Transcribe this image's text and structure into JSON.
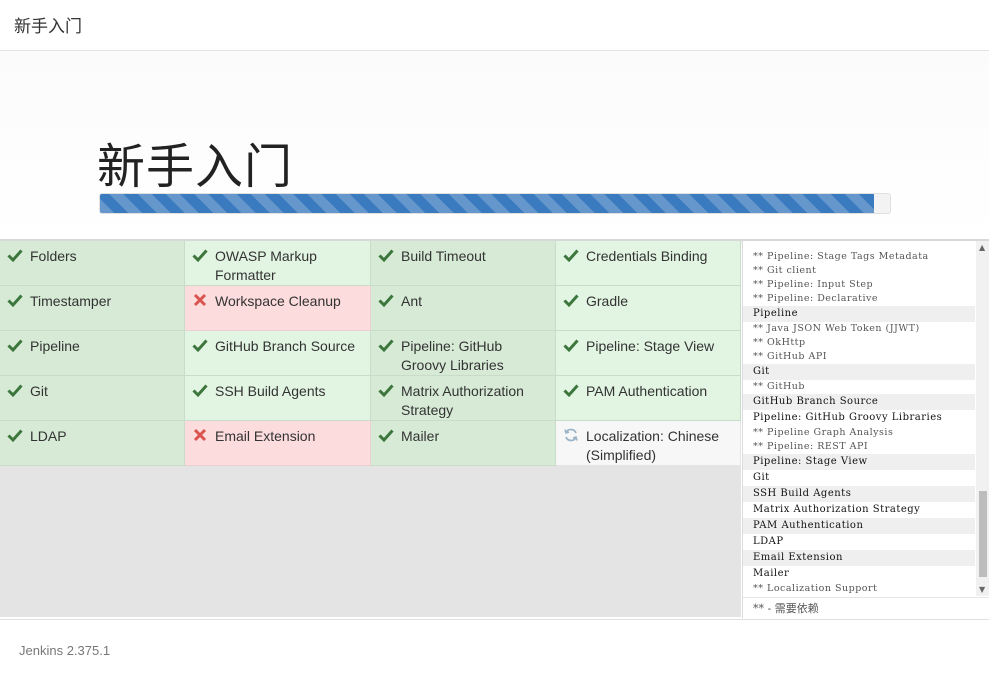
{
  "header": {
    "title": "新手入门"
  },
  "hero": {
    "heading": "新手入门",
    "progress_fraction": 0.98
  },
  "colors": {
    "success_icon": "#3c763d",
    "fail_icon": "#d9534f",
    "pending_icon": "#9cb4c8",
    "progress": "#3a7abf"
  },
  "plugins": [
    {
      "name": "Folders",
      "status": "success",
      "icon": "check-icon"
    },
    {
      "name": "OWASP Markup Formatter",
      "status": "success",
      "icon": "check-icon"
    },
    {
      "name": "Build Timeout",
      "status": "success",
      "icon": "check-icon"
    },
    {
      "name": "Credentials Binding",
      "status": "success",
      "icon": "check-icon"
    },
    {
      "name": "Timestamper",
      "status": "success",
      "icon": "check-icon"
    },
    {
      "name": "Workspace Cleanup",
      "status": "fail",
      "icon": "cross-icon"
    },
    {
      "name": "Ant",
      "status": "success",
      "icon": "check-icon"
    },
    {
      "name": "Gradle",
      "status": "success",
      "icon": "check-icon"
    },
    {
      "name": "Pipeline",
      "status": "success",
      "icon": "check-icon"
    },
    {
      "name": "GitHub Branch Source",
      "status": "success",
      "icon": "check-icon"
    },
    {
      "name": "Pipeline: GitHub Groovy Libraries",
      "status": "success",
      "icon": "check-icon"
    },
    {
      "name": "Pipeline: Stage View",
      "status": "success",
      "icon": "check-icon"
    },
    {
      "name": "Git",
      "status": "success",
      "icon": "check-icon"
    },
    {
      "name": "SSH Build Agents",
      "status": "success",
      "icon": "check-icon"
    },
    {
      "name": "Matrix Authorization Strategy",
      "status": "success",
      "icon": "check-icon"
    },
    {
      "name": "PAM Authentication",
      "status": "success",
      "icon": "check-icon"
    },
    {
      "name": "LDAP",
      "status": "success",
      "icon": "check-icon"
    },
    {
      "name": "Email Extension",
      "status": "fail",
      "icon": "cross-icon"
    },
    {
      "name": "Mailer",
      "status": "success",
      "icon": "check-icon"
    },
    {
      "name": "Localization: Chinese (Simplified)",
      "status": "pending",
      "icon": "spinner-icon"
    }
  ],
  "log": {
    "lines": [
      {
        "text": "** Pipeline: Stage Tags Metadata",
        "dep": true,
        "hl": false
      },
      {
        "text": "** Git client",
        "dep": true,
        "hl": false
      },
      {
        "text": "** Pipeline: Input Step",
        "dep": true,
        "hl": false
      },
      {
        "text": "** Pipeline: Declarative",
        "dep": true,
        "hl": false
      },
      {
        "text": "Pipeline",
        "dep": false,
        "hl": true
      },
      {
        "text": "** Java JSON Web Token (JJWT)",
        "dep": true,
        "hl": false
      },
      {
        "text": "** OkHttp",
        "dep": true,
        "hl": false
      },
      {
        "text": "** GitHub API",
        "dep": true,
        "hl": false
      },
      {
        "text": "Git",
        "dep": false,
        "hl": true
      },
      {
        "text": "** GitHub",
        "dep": true,
        "hl": false
      },
      {
        "text": "GitHub Branch Source",
        "dep": false,
        "hl": true
      },
      {
        "text": "Pipeline: GitHub Groovy Libraries",
        "dep": false,
        "hl": false
      },
      {
        "text": "** Pipeline Graph Analysis",
        "dep": true,
        "hl": false
      },
      {
        "text": "** Pipeline: REST API",
        "dep": true,
        "hl": false
      },
      {
        "text": "Pipeline: Stage View",
        "dep": false,
        "hl": true
      },
      {
        "text": "Git",
        "dep": false,
        "hl": false
      },
      {
        "text": "SSH Build Agents",
        "dep": false,
        "hl": true
      },
      {
        "text": "Matrix Authorization Strategy",
        "dep": false,
        "hl": false
      },
      {
        "text": "PAM Authentication",
        "dep": false,
        "hl": true
      },
      {
        "text": "LDAP",
        "dep": false,
        "hl": false
      },
      {
        "text": "Email Extension",
        "dep": false,
        "hl": true
      },
      {
        "text": "Mailer",
        "dep": false,
        "hl": false
      },
      {
        "text": "** Localization Support",
        "dep": true,
        "hl": false
      }
    ],
    "legend": "** - 需要依赖"
  },
  "footer": {
    "version": "Jenkins 2.375.1"
  }
}
